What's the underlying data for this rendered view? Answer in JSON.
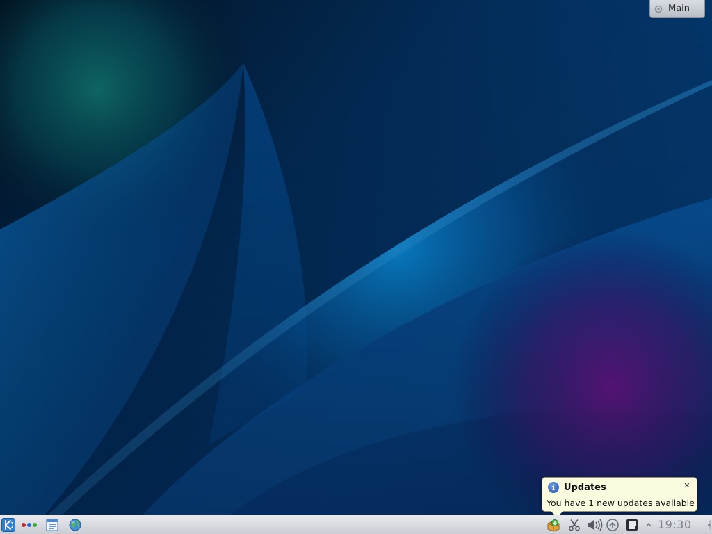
{
  "activity": {
    "label": "Main"
  },
  "notification": {
    "title": "Updates",
    "message": "You have 1 new updates available",
    "icon": "info-icon",
    "close_icon": "close-icon"
  },
  "panel": {
    "launchers": [
      {
        "icon": "kde-menu-icon"
      },
      {
        "icon": "pager-icon"
      },
      {
        "icon": "task-list-icon"
      },
      {
        "icon": "globe-icon"
      }
    ],
    "tray": [
      {
        "icon": "updates-icon"
      },
      {
        "icon": "scissors-icon"
      },
      {
        "icon": "volume-icon"
      },
      {
        "icon": "network-icon"
      },
      {
        "icon": "device-notifier-icon"
      },
      {
        "icon": "tray-arrow-icon"
      }
    ],
    "clock": "19:30"
  },
  "colors": {
    "wallpaper_base": "#033a6e",
    "wallpaper_highlight": "#0a9ff5",
    "wallpaper_teal": "#0c6b6a",
    "wallpaper_purple": "#7a1aa0",
    "notification_bg": "#fbfbe0",
    "panel_bg": "#dcdfe4"
  }
}
